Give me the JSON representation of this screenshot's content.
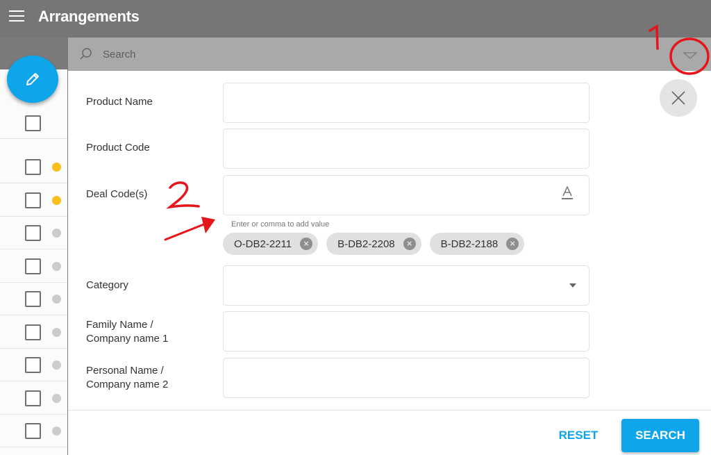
{
  "header": {
    "title": "Arrangements",
    "menu_icon": "hamburger-menu-icon"
  },
  "fab": {
    "icon": "pencil-icon",
    "color": "#0ea5ea"
  },
  "search": {
    "placeholder": "Search",
    "icon": "search-icon",
    "toggle_icon": "triangle-down-icon"
  },
  "list": {
    "rows": [
      {
        "status_color": "#fbbf1d"
      },
      {
        "status_color": "#fbbf1d"
      },
      {
        "status_color": "#cccccc"
      },
      {
        "status_color": "#cccccc"
      },
      {
        "status_color": "#cccccc"
      },
      {
        "status_color": "#cccccc"
      },
      {
        "status_color": "#cccccc"
      },
      {
        "status_color": "#cccccc"
      },
      {
        "status_color": "#cccccc"
      }
    ]
  },
  "form": {
    "fields": [
      {
        "label": "Product Name",
        "value": ""
      },
      {
        "label": "Product Code",
        "value": ""
      },
      {
        "label": "Deal Code(s)",
        "value": "",
        "hint": "Enter or comma to add value",
        "chips": [
          "O-DB2-2211",
          "B-DB2-2208",
          "B-DB2-2188"
        ]
      },
      {
        "label": "Category",
        "value": ""
      },
      {
        "label_line1": "Family Name /",
        "label_line2": "Company name 1",
        "value": ""
      },
      {
        "label_line1": "Personal Name /",
        "label_line2": "Company name 2",
        "value": ""
      }
    ],
    "reset_label": "RESET",
    "search_label": "SEARCH",
    "accent_color": "#0ea5ea"
  },
  "annotations": {
    "label_1": "1",
    "label_2": "2",
    "color": "#e8141b"
  }
}
